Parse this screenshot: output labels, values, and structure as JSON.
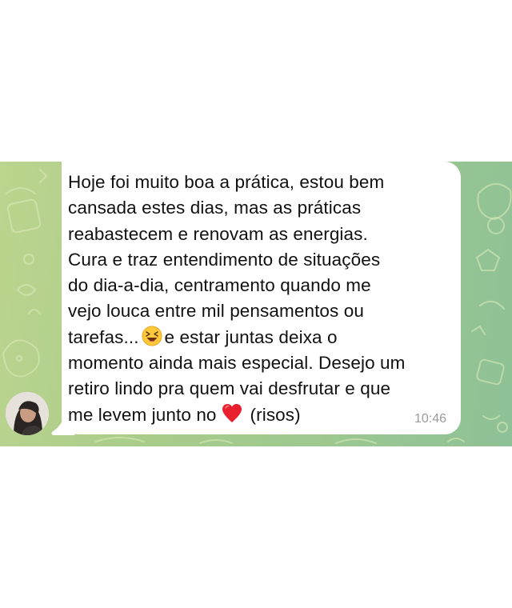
{
  "message": {
    "lines": [
      "Hoje foi muito boa a prática, estou bem",
      "cansada estes dias, mas as práticas",
      "reabastecem e renovam as energias.",
      "Cura e traz entendimento de situações",
      "do dia-a-dia, centramento quando me",
      "vejo louca entre mil pensamentos ou"
    ],
    "line7_before_emoji": "tarefas...",
    "line7_after_emoji": "e estar juntas deixa o",
    "line8": "momento ainda mais especial. Desejo um",
    "line9": "retiro lindo pra quem vai desfrutar e que",
    "line10_before_emoji": "me levem junto no",
    "line10_after_emoji": "(risos)",
    "time": "10:46"
  },
  "emojis": {
    "laughing": "laughing-squinting-face-emoji",
    "heart": "red-heart-emoji"
  },
  "colors": {
    "bubble": "#ffffff",
    "text": "#111111",
    "timestamp": "#9a9a9a",
    "wallpaper": "#a9cc8a",
    "heart": "#e8202e"
  }
}
